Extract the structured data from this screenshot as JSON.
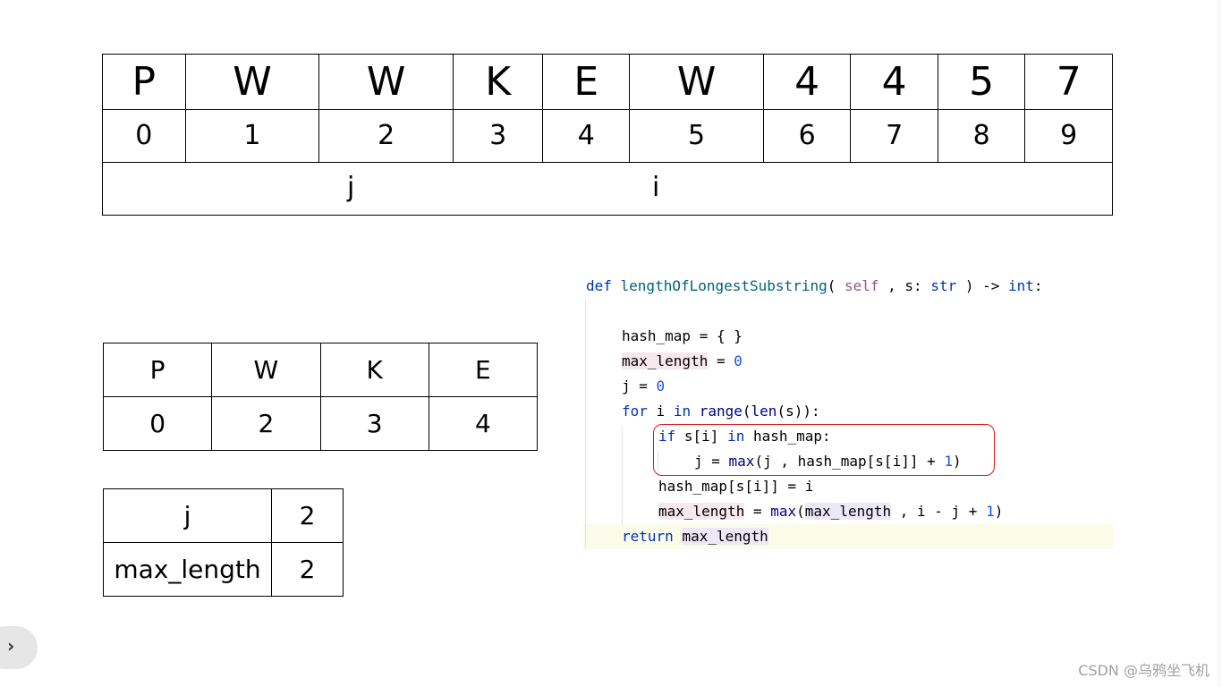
{
  "array": {
    "chars": [
      "P",
      "W",
      "W",
      "K",
      "E",
      "W",
      "4",
      "4",
      "5",
      "7"
    ],
    "indices": [
      "0",
      "1",
      "2",
      "3",
      "4",
      "5",
      "6",
      "7",
      "8",
      "9"
    ],
    "pointer_j": "j",
    "pointer_i": "i"
  },
  "hash_map": {
    "keys": [
      "P",
      "W",
      "K",
      "E"
    ],
    "values": [
      "0",
      "2",
      "3",
      "4"
    ]
  },
  "vars": [
    {
      "name": "j",
      "value": "2"
    },
    {
      "name": "max_length",
      "value": "2"
    }
  ],
  "code": {
    "line1": {
      "def": "def ",
      "fn": "lengthOfLongestSubstring",
      "p1": "( ",
      "self": "self",
      "p2": " , s: ",
      "str": "str",
      "p3": " ) -> ",
      "int": "int",
      "p4": ":"
    },
    "line2": "hash_map = { }",
    "line3": {
      "v": "max_length",
      "op": " = ",
      "n": "0"
    },
    "line4": {
      "v": "j = ",
      "n": "0"
    },
    "line5": {
      "kw1": "for",
      "t1": " i ",
      "kw2": "in",
      "t2": " ",
      "b1": "range",
      "t3": "(",
      "b2": "len",
      "t4": "(s)):"
    },
    "line6": {
      "kw1": "if",
      "t1": " s[i] ",
      "kw2": "in",
      "t2": " hash_map:"
    },
    "line7": {
      "t1": "j = ",
      "b": "max",
      "t2": "(j , hash_map[s[i]] + ",
      "n": "1",
      "t3": ")"
    },
    "line8": "hash_map[s[i]] = i",
    "line9": {
      "v": "max_length",
      "t1": " = ",
      "b": "max",
      "t2": "(",
      "v2": "max_length",
      "t3": " , i - j + ",
      "n": "1",
      "t4": ")"
    },
    "line10": {
      "kw": "return",
      "t": " ",
      "v": "max_length"
    }
  },
  "watermark": "CSDN @乌鸦坐飞机",
  "icons": {
    "side_handle": "chevron-right-icon"
  }
}
